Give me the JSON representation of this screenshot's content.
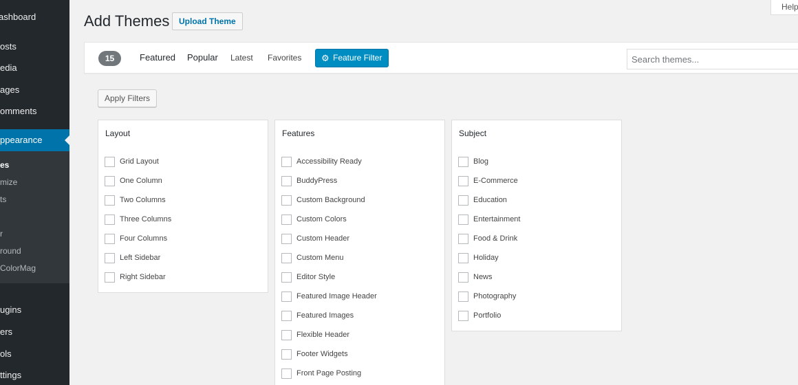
{
  "sidebar": {
    "items": [
      {
        "label": "ashboard"
      },
      {
        "label": "osts"
      },
      {
        "label": "edia"
      },
      {
        "label": "ages"
      },
      {
        "label": "omments"
      },
      {
        "label": "ppearance"
      },
      {
        "label": "ugins"
      },
      {
        "label": "ers"
      },
      {
        "label": "ols"
      },
      {
        "label": "ttings"
      }
    ],
    "submenu": [
      {
        "label": "es"
      },
      {
        "label": "mize"
      },
      {
        "label": "ts"
      },
      {
        "label": "r"
      },
      {
        "label": "round"
      },
      {
        "label": "ColorMag"
      }
    ]
  },
  "header": {
    "title": "Add Themes",
    "upload_label": "Upload Theme",
    "help_label": "Help"
  },
  "filter_bar": {
    "count": "15",
    "tabs": [
      "Featured",
      "Popular",
      "Latest",
      "Favorites"
    ],
    "feature_filter_label": "Feature Filter",
    "search_placeholder": "Search themes..."
  },
  "apply_label": "Apply Filters",
  "groups": [
    {
      "title": "Layout",
      "options": [
        "Grid Layout",
        "One Column",
        "Two Columns",
        "Three Columns",
        "Four Columns",
        "Left Sidebar",
        "Right Sidebar"
      ]
    },
    {
      "title": "Features",
      "options": [
        "Accessibility Ready",
        "BuddyPress",
        "Custom Background",
        "Custom Colors",
        "Custom Header",
        "Custom Menu",
        "Editor Style",
        "Featured Image Header",
        "Featured Images",
        "Flexible Header",
        "Footer Widgets",
        "Front Page Posting"
      ]
    },
    {
      "title": "Subject",
      "options": [
        "Blog",
        "E-Commerce",
        "Education",
        "Entertainment",
        "Food & Drink",
        "Holiday",
        "News",
        "Photography",
        "Portfolio"
      ]
    }
  ],
  "colors": {
    "accent": "#0073aa",
    "sidebar_bg": "#23282d",
    "button_primary": "#008ec2"
  },
  "icons": {
    "feature_filter": "gear-icon"
  }
}
